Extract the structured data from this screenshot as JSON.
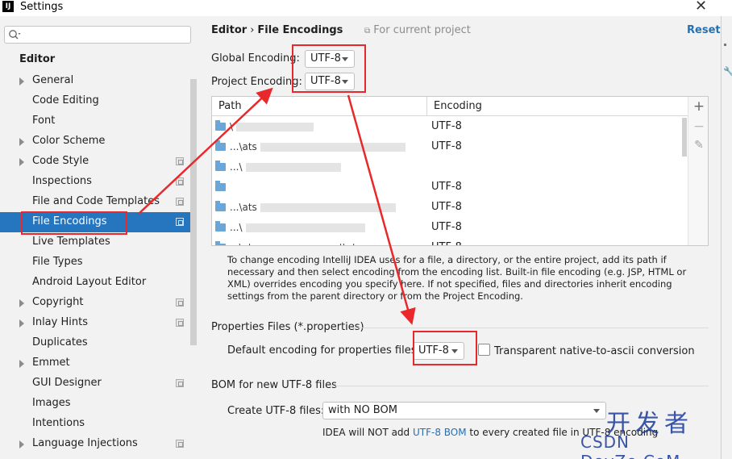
{
  "window": {
    "title": "Settings",
    "app_icon": "IJ"
  },
  "sidebar": {
    "search_placeholder": "Q▾",
    "heading": "Editor",
    "items": [
      {
        "label": "General",
        "expandable": true,
        "project": false
      },
      {
        "label": "Code Editing",
        "expandable": false,
        "project": false
      },
      {
        "label": "Font",
        "expandable": false,
        "project": false
      },
      {
        "label": "Color Scheme",
        "expandable": true,
        "project": false
      },
      {
        "label": "Code Style",
        "expandable": true,
        "project": true
      },
      {
        "label": "Inspections",
        "expandable": false,
        "project": true
      },
      {
        "label": "File and Code Templates",
        "expandable": false,
        "project": true
      },
      {
        "label": "File Encodings",
        "expandable": false,
        "project": true,
        "selected": true
      },
      {
        "label": "Live Templates",
        "expandable": false,
        "project": false
      },
      {
        "label": "File Types",
        "expandable": false,
        "project": false
      },
      {
        "label": "Android Layout Editor",
        "expandable": false,
        "project": false
      },
      {
        "label": "Copyright",
        "expandable": true,
        "project": true
      },
      {
        "label": "Inlay Hints",
        "expandable": true,
        "project": true
      },
      {
        "label": "Duplicates",
        "expandable": false,
        "project": false
      },
      {
        "label": "Emmet",
        "expandable": true,
        "project": false
      },
      {
        "label": "GUI Designer",
        "expandable": false,
        "project": true
      },
      {
        "label": "Images",
        "expandable": false,
        "project": false
      },
      {
        "label": "Intentions",
        "expandable": false,
        "project": false
      },
      {
        "label": "Language Injections",
        "expandable": true,
        "project": true
      }
    ]
  },
  "main": {
    "breadcrumb": {
      "parent": "Editor",
      "separator": "›",
      "current": "File Encodings"
    },
    "for_project": "For current project",
    "reset": "Reset",
    "global_encoding": {
      "label": "Global Encoding:",
      "value": "UTF-8"
    },
    "project_encoding": {
      "label": "Project Encoding:",
      "value": "UTF-8"
    },
    "table": {
      "columns": [
        "Path",
        "Encoding"
      ],
      "rows": [
        {
          "path": "\\",
          "encoding": "UTF-8"
        },
        {
          "path": "...\\ats",
          "encoding": "UTF-8"
        },
        {
          "path": "...\\",
          "encoding": ""
        },
        {
          "path": "",
          "encoding": "UTF-8"
        },
        {
          "path": "...\\ats",
          "encoding": "UTF-8"
        },
        {
          "path": "...\\",
          "encoding": "UTF-8"
        },
        {
          "path": "...\\ats-rsc-management\\ats-rsc-managem",
          "encoding": "UTF-8"
        }
      ],
      "tools": {
        "add": "+",
        "remove": "−",
        "edit": "✎"
      }
    },
    "help_text": "To change encoding IntelliJ IDEA uses for a file, a directory, or the entire project, add its path if necessary and then select encoding from the encoding list. Built-in file encoding (e.g. JSP, HTML or XML) overrides encoding you specify here. If not specified, files and directories inherit encoding settings from the parent directory or from the Project Encoding.",
    "properties": {
      "title": "Properties Files (*.properties)",
      "default_label": "Default encoding for properties files:",
      "default_value": "UTF-8",
      "transparent_label": "Transparent native-to-ascii conversion",
      "transparent_checked": false
    },
    "bom": {
      "title": "BOM for new UTF-8 files",
      "create_label": "Create UTF-8 files:",
      "create_value": "with NO BOM",
      "note_prefix": "IDEA will NOT add ",
      "note_link": "UTF-8 BOM",
      "note_suffix": " to every created file in UTF-8 encoding"
    }
  },
  "watermark": {
    "line1": "开发者",
    "line2": "CSDN DevZe.CoM"
  },
  "annotation_color": "#e8282b"
}
